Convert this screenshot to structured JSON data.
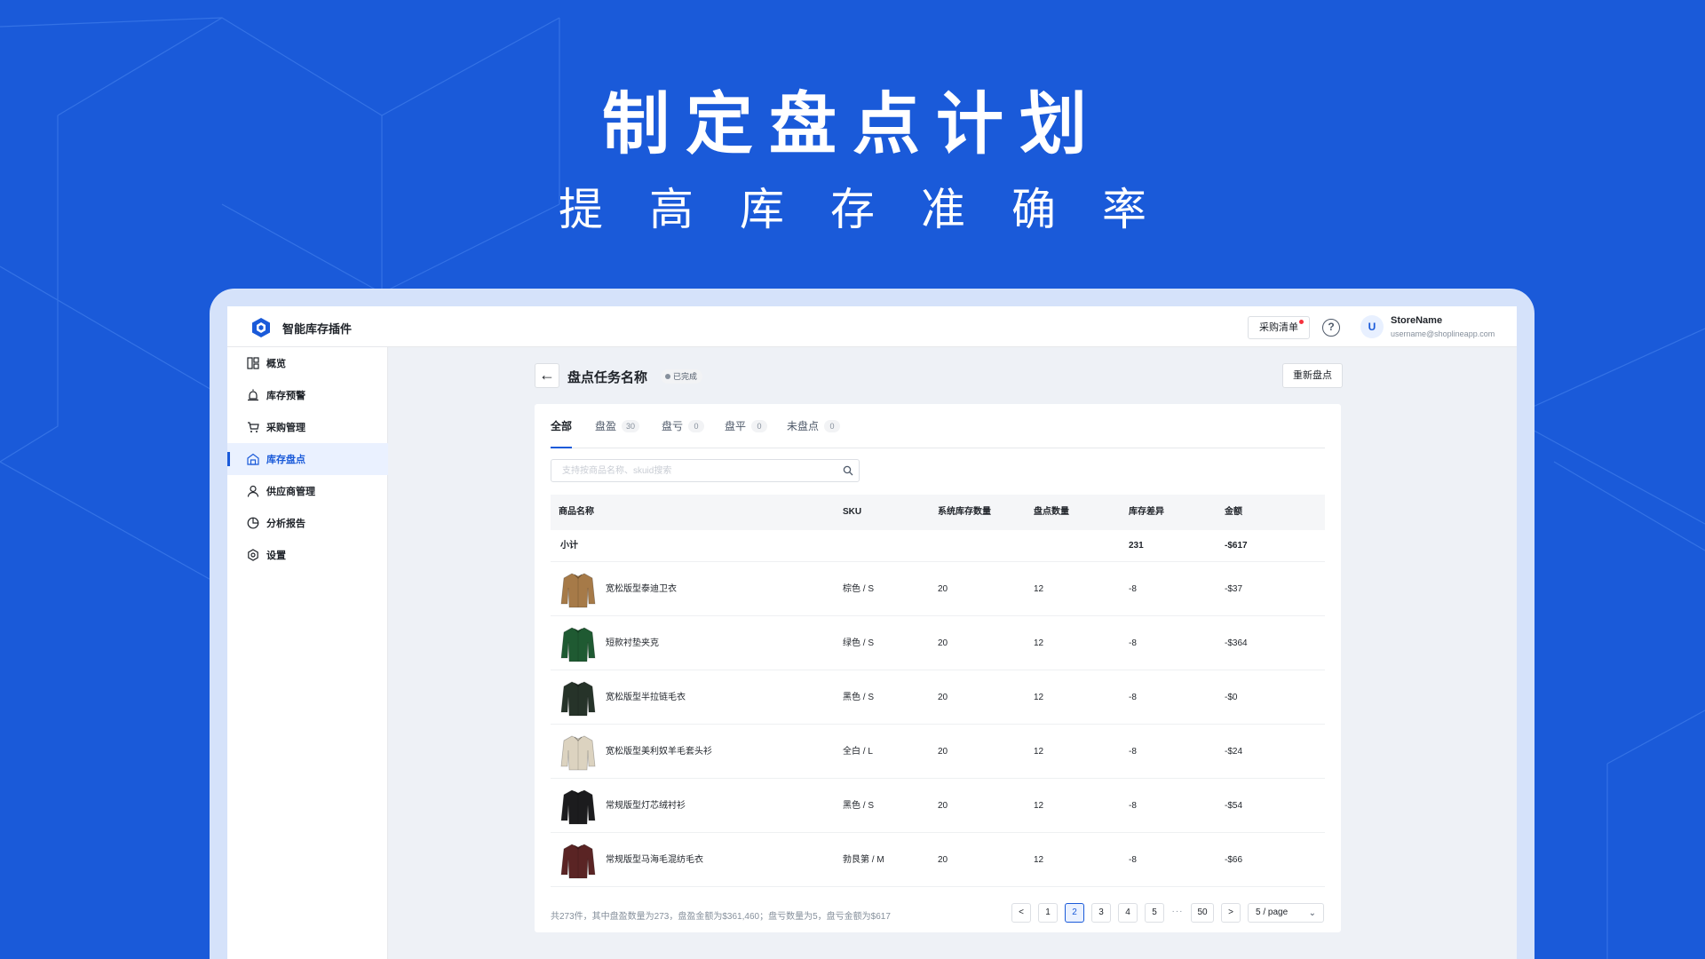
{
  "hero": {
    "title": "制定盘点计划",
    "subtitle": "提高库存准确率"
  },
  "topbar": {
    "app_name": "智能库存插件",
    "cart_label": "采购清单",
    "help_icon": "help-circle-icon",
    "avatar_initial": "U",
    "store_name": "StoreName",
    "store_email": "username@shoplineapp.com"
  },
  "sidebar": {
    "items": [
      {
        "label": "概览",
        "icon": "dashboard-icon"
      },
      {
        "label": "库存预警",
        "icon": "alarm-icon"
      },
      {
        "label": "采购管理",
        "icon": "cart-icon"
      },
      {
        "label": "库存盘点",
        "icon": "warehouse-icon",
        "active": true
      },
      {
        "label": "供应商管理",
        "icon": "user-icon"
      },
      {
        "label": "分析报告",
        "icon": "pie-chart-icon"
      },
      {
        "label": "设置",
        "icon": "settings-icon"
      }
    ]
  },
  "page": {
    "title": "盘点任务名称",
    "status": "已完成",
    "recount_label": "重新盘点"
  },
  "tabs": [
    {
      "label": "全部",
      "count": "",
      "active": true
    },
    {
      "label": "盘盈",
      "count": "30"
    },
    {
      "label": "盘亏",
      "count": "0"
    },
    {
      "label": "盘平",
      "count": "0"
    },
    {
      "label": "未盘点",
      "count": "0"
    }
  ],
  "search": {
    "placeholder": "支持按商品名称、skuid搜索"
  },
  "table": {
    "headers": [
      "商品名称",
      "SKU",
      "系统库存数量",
      "盘点数量",
      "库存差异",
      "金额"
    ],
    "subtotal": {
      "label": "小计",
      "diff": "231",
      "amount": "-$617"
    },
    "rows": [
      {
        "name": "宽松版型泰迪卫衣",
        "sku": "棕色 / S",
        "system": "20",
        "counted": "12",
        "diff": "-8",
        "amount": "-$37",
        "color": "#a67a48"
      },
      {
        "name": "短款衬垫夹克",
        "sku": "绿色 / S",
        "system": "20",
        "counted": "12",
        "diff": "-8",
        "amount": "-$364",
        "color": "#1f5a32"
      },
      {
        "name": "宽松版型半拉链毛衣",
        "sku": "黑色 / S",
        "system": "20",
        "counted": "12",
        "diff": "-8",
        "amount": "-$0",
        "color": "#263329"
      },
      {
        "name": "宽松版型美利奴羊毛套头衫",
        "sku": "全白 / L",
        "system": "20",
        "counted": "12",
        "diff": "-8",
        "amount": "-$24",
        "color": "#dcd3c0"
      },
      {
        "name": "常规版型灯芯绒衬衫",
        "sku": "黑色 / S",
        "system": "20",
        "counted": "12",
        "diff": "-8",
        "amount": "-$54",
        "color": "#1c1c1e"
      },
      {
        "name": "常规版型马海毛混纺毛衣",
        "sku": "勃艮第 / M",
        "system": "20",
        "counted": "12",
        "diff": "-8",
        "amount": "-$66",
        "color": "#5a2424"
      }
    ]
  },
  "footer": {
    "summary": "共273件，其中盘盈数量为273，盘盈金额为$361,460；盘亏数量为5，盘亏金额为$617"
  },
  "pagination": {
    "prev": "<",
    "pages": [
      "1",
      "2",
      "3",
      "4",
      "5"
    ],
    "active_page": "2",
    "ellipsis": "···",
    "last": "50",
    "next": ">",
    "page_size": "5 / page"
  },
  "colors": {
    "background": "#1a5ad9",
    "accent": "#1a5ad9",
    "badge_red": "#f5313d"
  }
}
